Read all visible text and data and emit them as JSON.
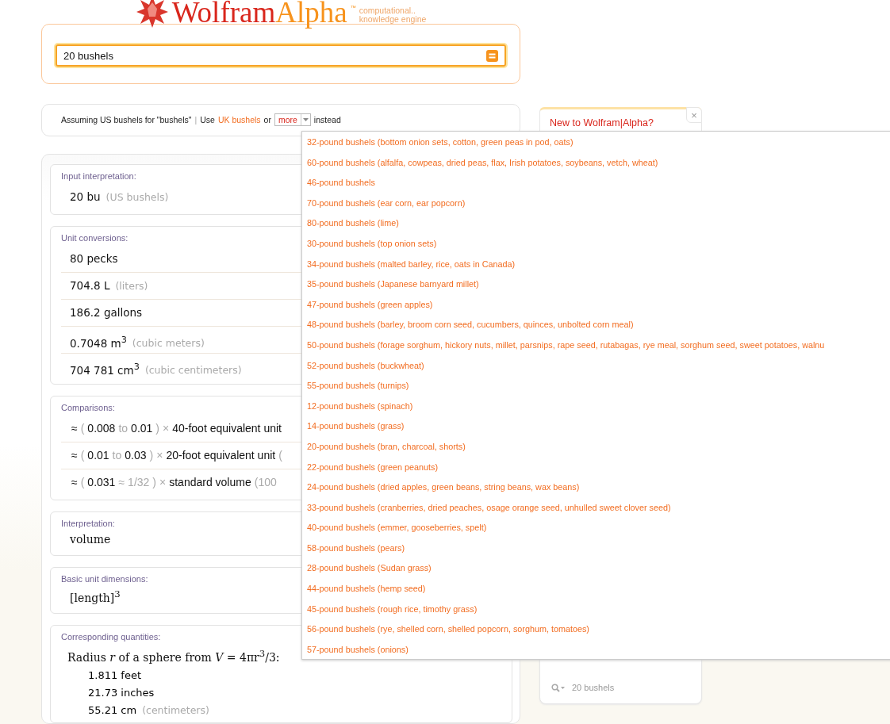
{
  "logo": {
    "first": "Wolfram",
    "second": "Alpha",
    "tm": "™",
    "tagline_1": "computational..",
    "tagline_2": "knowledge engine"
  },
  "search": {
    "value": "20 bushels"
  },
  "assumption": {
    "lead": "Assuming US bushels for \"bushels\"",
    "separator": "|",
    "use": "Use",
    "link": "UK bushels",
    "or": "or",
    "select": {
      "value": "more",
      "expanded": true
    },
    "tail": "instead",
    "options": [
      "32-pound bushels (bottom onion sets, cotton, green peas in pod, oats)",
      "60-pound bushels (alfalfa, cowpeas, dried peas, flax, Irish potatoes, soybeans, vetch, wheat)",
      "46-pound bushels",
      "70-pound bushels (ear corn, ear popcorn)",
      "80-pound bushels (lime)",
      "30-pound bushels (top onion sets)",
      "34-pound bushels (malted barley, rice, oats in Canada)",
      "35-pound bushels (Japanese barnyard millet)",
      "47-pound bushels (green apples)",
      "48-pound bushels (barley, broom corn seed, cucumbers, quinces, unbolted corn meal)",
      "50-pound bushels (forage sorghum, hickory nuts, millet, parsnips, rape seed, rutabagas, rye meal, sorghum seed, sweet potatoes, walnu",
      "52-pound bushels (buckwheat)",
      "55-pound bushels (turnips)",
      "12-pound bushels (spinach)",
      "14-pound bushels (grass)",
      "20-pound bushels (bran, charcoal, shorts)",
      "22-pound bushels (green peanuts)",
      "24-pound bushels (dried apples, green beans, string beans, wax beans)",
      "33-pound bushels (cranberries, dried peaches, osage orange seed, unhulled sweet clover seed)",
      "40-pound bushels (emmer, gooseberries, spelt)",
      "58-pound bushels (pears)",
      "28-pound bushels (Sudan grass)",
      "44-pound bushels (hemp seed)",
      "45-pound bushels (rough rice, timothy grass)",
      "56-pound bushels (rye, shelled corn, shelled popcorn, sorghum, tomatoes)",
      "57-pound bushels (onions)"
    ]
  },
  "pods": [
    {
      "kind": "simple",
      "title": "Input interpretation:",
      "rows": [
        {
          "text": "20 bu",
          "note": "(US bushels)"
        }
      ]
    },
    {
      "kind": "simple",
      "title": "Unit conversions:",
      "rows": [
        {
          "text": "80 pecks"
        },
        {
          "text": "704.8 L",
          "note": "(liters)"
        },
        {
          "text": "186.2 gallons"
        },
        {
          "text": "0.7048 m$^{3}$",
          "note": "(cubic meters)"
        },
        {
          "text": "704 781 cm$^{3}$",
          "note": "(cubic centimeters)"
        }
      ]
    },
    {
      "kind": "parts",
      "title": "Comparisons:",
      "rows": [
        {
          "approx": "≈",
          "open": "(",
          "from": "0.008",
          "link": "to",
          "until": "0.01",
          "until_muted": false,
          "close": ")",
          "times": "×",
          "unit": "40-foot equivalent unit"
        },
        {
          "approx": "≈",
          "open": "(",
          "from": "0.01",
          "link": "to",
          "until": "0.03",
          "until_muted": false,
          "close": ")",
          "times": "×",
          "unit": "20-foot equivalent unit",
          "note": "("
        },
        {
          "approx": "≈",
          "open": "(",
          "from": "0.031",
          "link": "≈",
          "until": "1/32",
          "until_muted": true,
          "close": ")",
          "times": "×",
          "unit": "standard volume",
          "note": "(100"
        }
      ]
    },
    {
      "kind": "serif",
      "title": "Interpretation:",
      "rows": [
        {
          "text": "volume"
        }
      ]
    },
    {
      "kind": "serif",
      "title": "Basic unit dimensions:",
      "rows": [
        {
          "text": "[length]$^{3}$"
        }
      ]
    },
    {
      "kind": "formula",
      "title": "Corresponding quantities:",
      "formula": "Radius *r* of a sphere from *V* = 4πr$^{3}$/3:",
      "rows": [
        {
          "text": "1.811 feet"
        },
        {
          "text": "21.73 inches"
        },
        {
          "text": "55.21 cm",
          "note": "(centimeters)"
        }
      ]
    }
  ],
  "sidebar": {
    "promo_title": "New to Wolfram|Alpha?",
    "close": "×",
    "history": "20 bushels"
  }
}
